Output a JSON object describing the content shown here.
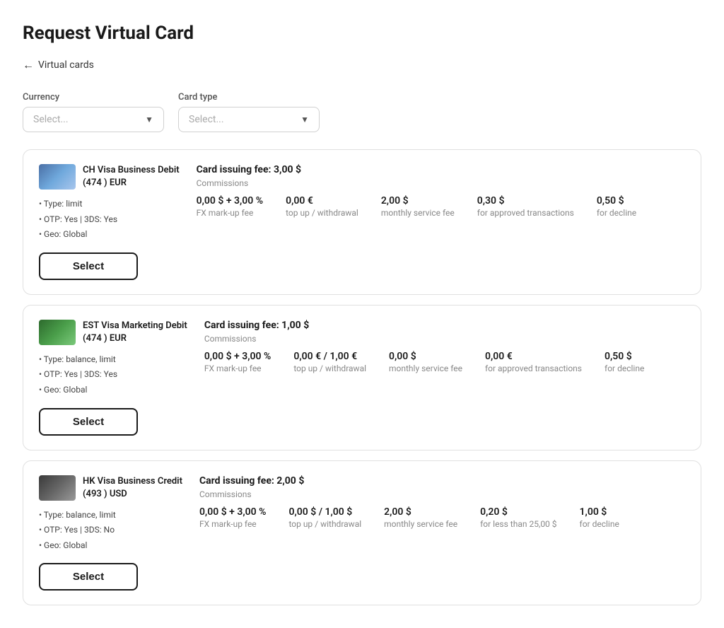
{
  "page": {
    "title": "Request Virtual Card",
    "back_label": "Virtual cards"
  },
  "filters": {
    "currency": {
      "label": "Currency",
      "placeholder": "Select..."
    },
    "card_type": {
      "label": "Card type",
      "placeholder": "Select..."
    }
  },
  "cards": [
    {
      "id": "ch-visa",
      "thumbnail_type": "ch",
      "name": "CH Visa Business Debit (474    ) EUR",
      "name_short": "CH Visa Business Debit",
      "name_suffix": "(474    ) EUR",
      "type": "Type: limit",
      "otp": "OTP: Yes | 3DS: Yes",
      "geo": "Geo: Global",
      "issuing_fee": "Card issuing fee: 3,00 $",
      "commissions_label": "Commissions",
      "commissions": [
        {
          "value": "0,00 $ + 3,00 %",
          "desc": "FX mark-up fee"
        },
        {
          "value": "0,00 €",
          "desc": "top up / withdrawal"
        },
        {
          "value": "2,00 $",
          "desc": "monthly service fee"
        },
        {
          "value": "0,30 $",
          "desc": "for approved transactions"
        },
        {
          "value": "0,50 $",
          "desc": "for decline"
        }
      ],
      "select_label": "Select"
    },
    {
      "id": "est-visa",
      "thumbnail_type": "est",
      "name": "EST Visa Marketing Debit (474    ) EUR",
      "name_short": "EST Visa Marketing Debit",
      "name_suffix": "(474    ) EUR",
      "type": "Type: balance, limit",
      "otp": "OTP: Yes | 3DS: Yes",
      "geo": "Geo: Global",
      "issuing_fee": "Card issuing fee: 1,00 $",
      "commissions_label": "Commissions",
      "commissions": [
        {
          "value": "0,00 $ + 3,00 %",
          "desc": "FX mark-up fee"
        },
        {
          "value": "0,00 € / 1,00 €",
          "desc": "top up / withdrawal"
        },
        {
          "value": "0,00 $",
          "desc": "monthly service fee"
        },
        {
          "value": "0,00 €",
          "desc": "for approved transactions"
        },
        {
          "value": "0,50 $",
          "desc": "for decline"
        }
      ],
      "select_label": "Select"
    },
    {
      "id": "hk-visa",
      "thumbnail_type": "hk",
      "name": "HK Visa Business Credit (493    ) USD",
      "name_short": "HK Visa Business Credit",
      "name_suffix": "(493    ) USD",
      "type": "Type: balance, limit",
      "otp": "OTP: Yes | 3DS: No",
      "geo": "Geo: Global",
      "issuing_fee": "Card issuing fee: 2,00 $",
      "commissions_label": "Commissions",
      "commissions": [
        {
          "value": "0,00 $ + 3,00 %",
          "desc": "FX mark-up fee"
        },
        {
          "value": "0,00 $ / 1,00 $",
          "desc": "top up / withdrawal"
        },
        {
          "value": "2,00 $",
          "desc": "monthly service fee"
        },
        {
          "value": "0,20 $",
          "desc": "for less than 25,00 $"
        },
        {
          "value": "1,00 $",
          "desc": "for decline"
        }
      ],
      "select_label": "Select"
    }
  ]
}
